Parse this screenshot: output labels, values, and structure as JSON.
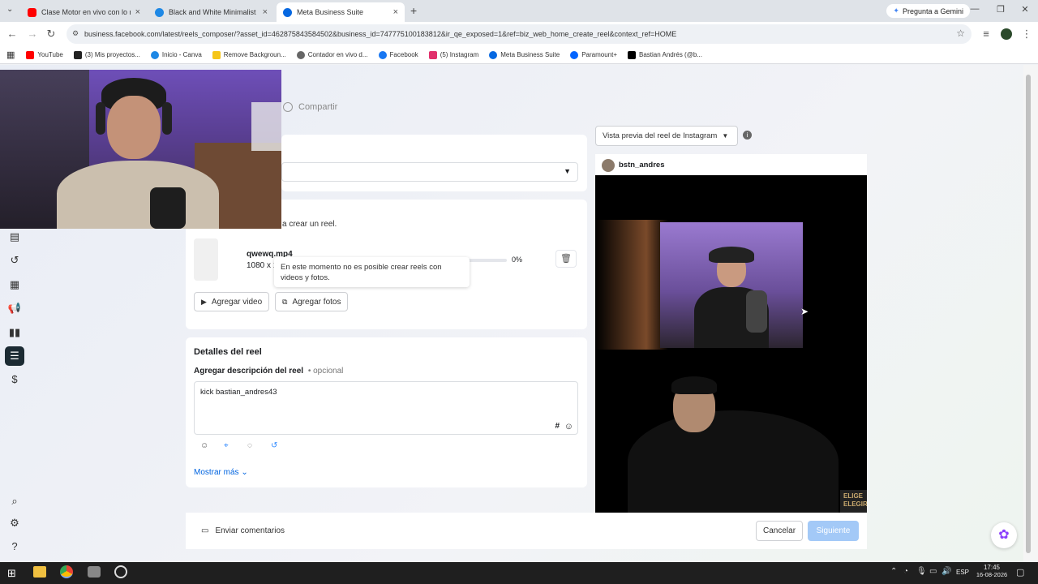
{
  "browser": {
    "tabs": [
      {
        "title": "Clase Motor en vivo con lo mejor",
        "favicon_color": "#ff0000"
      },
      {
        "title": "Black and White Minimalist Sim",
        "favicon_color": "#1e88e5"
      },
      {
        "title": "Meta Business Suite",
        "favicon_color": "#0668e1"
      }
    ],
    "gemini_label": "Pregunta a Gemini",
    "url": "business.facebook.com/latest/reels_composer/?asset_id=462875843584502&business_id=747775100183812&ir_qe_exposed=1&ref=biz_web_home_create_reel&context_ref=HOME",
    "bookmarks": [
      "YouTube",
      "(3) Mis proyectos...",
      "Inicio - Canva",
      "Remove Backgroun...",
      "Contador en vivo d...",
      "Facebook",
      "(5) Instagram",
      "Meta Business Suite",
      "Paramount+",
      "Bastian Andrés (@b..."
    ]
  },
  "composer": {
    "share_label": "Compartir",
    "media_hint": "a crear un reel.",
    "file": {
      "name": "qwewq.mp4",
      "dims": "1080 x 1",
      "progress_label": "0%",
      "progress": 0
    },
    "tooltip": "En este momento no es posible crear reels con videos y fotos.",
    "add_video": "Agregar video",
    "add_photos": "Agregar fotos",
    "details_title": "Detalles del reel",
    "description_label": "Agregar descripción del reel",
    "optional": "• opcional",
    "description_value": "kick bastian_andres43",
    "hashtag": "#",
    "show_more": "Mostrar más",
    "feedback": "Enviar comentarios",
    "cancel": "Cancelar",
    "next": "Siguiente"
  },
  "preview": {
    "selector": "Vista previa del reel de Instagram",
    "username": "bstn_andres",
    "overlay_text": [
      "ELIGE",
      "ELEGIR"
    ]
  },
  "taskbar": {
    "lang": "ESP",
    "time": "17:45",
    "date": "16-08-2026"
  },
  "colors": {
    "accent": "#0064e0",
    "nav_active": "#1c2b33",
    "next_disabled": "#a3c9f7"
  }
}
